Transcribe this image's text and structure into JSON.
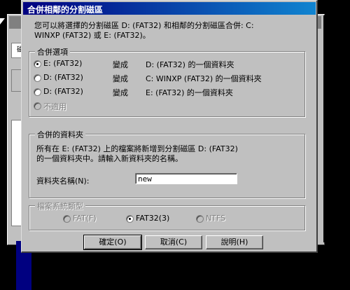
{
  "dialog": {
    "title": "合併相鄰的分割磁區",
    "description_line1": "您可以將選擇的分割磁區 D: (FAT32) 和相鄰的分割磁區合併: C:",
    "description_line2": "WINXP (FAT32) 或 E: (FAT32)。"
  },
  "merge_options": {
    "legend": "合併選項",
    "options": [
      {
        "source": "E: (FAT32)",
        "verb": "變成",
        "target": "D: (FAT32) 的一個資料夾",
        "checked": true
      },
      {
        "source": "D: (FAT32)",
        "verb": "變成",
        "target": "C: WINXP (FAT32) 的一個資料夾",
        "checked": false
      },
      {
        "source": "D: (FAT32)",
        "verb": "變成",
        "target": "E: (FAT32) 的一個資料夾",
        "checked": false
      }
    ],
    "not_applicable": "不適用"
  },
  "merged_folder": {
    "legend": "合併的資料夾",
    "desc_line1": "所有在 E: (FAT32) 上的檔案將新增到分割磁區 D: (FAT32)",
    "desc_line2": "的一個資料夾中。請輸入新資料夾的名稱。",
    "name_label": "資料夾名稱(N):",
    "name_value": "new"
  },
  "filesystem": {
    "legend": "檔案系統類型",
    "options": [
      "FAT(F)",
      "FAT32(3)",
      "NTFS"
    ],
    "selected": "FAT32(3)"
  },
  "buttons": {
    "ok": "確定(O)",
    "cancel": "取消(C)",
    "help": "說明(H)"
  },
  "background": {
    "toolbar_glyph": "磁"
  },
  "colors": {
    "title_start": "#000080",
    "title_end": "#1084d0",
    "face": "#c0c0c0"
  }
}
